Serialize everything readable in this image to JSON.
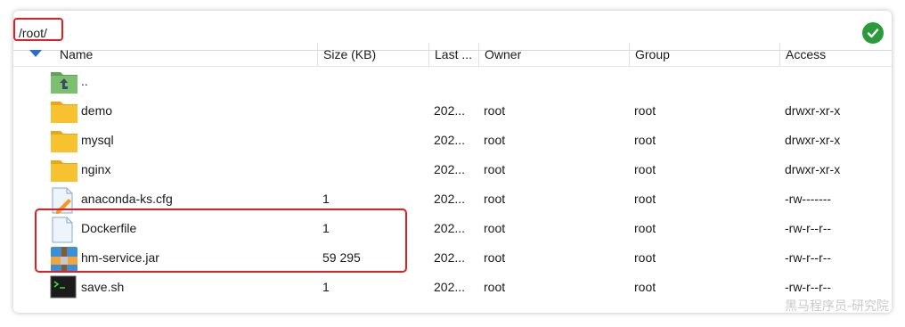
{
  "path_bar": {
    "value": "/root/",
    "status_icon": "check-circle-icon",
    "status_color": "#2a9a3a"
  },
  "columns": {
    "name": "Name",
    "size": "Size (KB)",
    "last": "Last ...",
    "owner": "Owner",
    "group": "Group",
    "access": "Access"
  },
  "rows": [
    {
      "icon": "parent-folder-icon",
      "name": "..",
      "size": "",
      "last": "",
      "owner": "",
      "group": "",
      "access": ""
    },
    {
      "icon": "folder-icon",
      "name": "demo",
      "size": "",
      "last": "202...",
      "owner": "root",
      "group": "root",
      "access": "drwxr-xr-x"
    },
    {
      "icon": "folder-icon",
      "name": "mysql",
      "size": "",
      "last": "202...",
      "owner": "root",
      "group": "root",
      "access": "drwxr-xr-x"
    },
    {
      "icon": "folder-icon",
      "name": "nginx",
      "size": "",
      "last": "202...",
      "owner": "root",
      "group": "root",
      "access": "drwxr-xr-x"
    },
    {
      "icon": "config-file-icon",
      "name": "anaconda-ks.cfg",
      "size": "1",
      "last": "202...",
      "owner": "root",
      "group": "root",
      "access": "-rw-------"
    },
    {
      "icon": "file-icon",
      "name": "Dockerfile",
      "size": "1",
      "last": "202...",
      "owner": "root",
      "group": "root",
      "access": "-rw-r--r--"
    },
    {
      "icon": "jar-archive-icon",
      "name": "hm-service.jar",
      "size": "59 295",
      "last": "202...",
      "owner": "root",
      "group": "root",
      "access": "-rw-r--r--"
    },
    {
      "icon": "terminal-script-icon",
      "name": "save.sh",
      "size": "1",
      "last": "202...",
      "owner": "root",
      "group": "root",
      "access": "-rw-r--r--"
    }
  ],
  "colors": {
    "annotation_red": "#e02020",
    "folder_yellow": "#f7c22f",
    "sort_blue": "#2a6fd0"
  },
  "watermark": "黑马程序员-研究院"
}
